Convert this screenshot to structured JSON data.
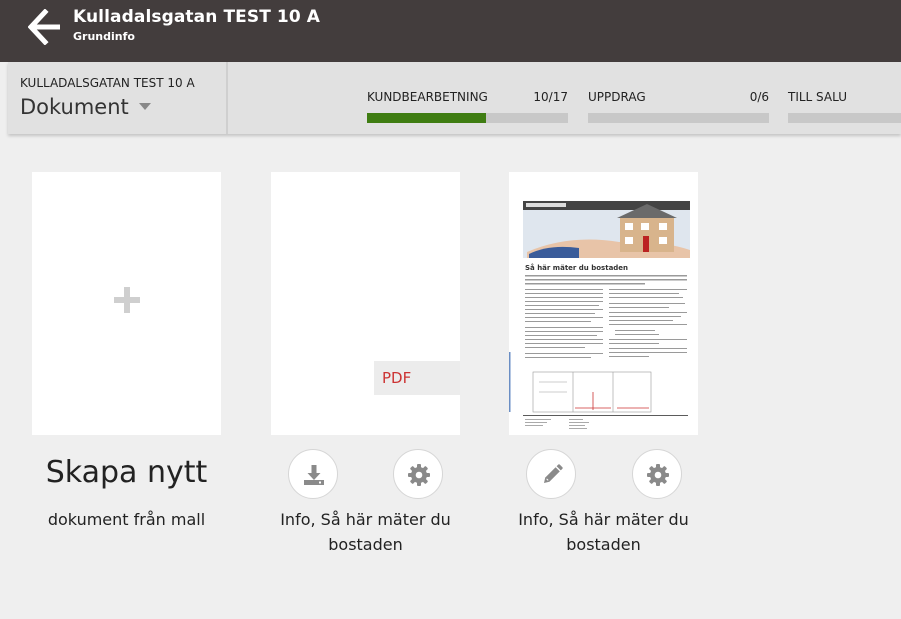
{
  "header": {
    "title": "Kulladalsgatan TEST 10 A",
    "subtitle": "Grundinfo",
    "back_icon": "arrow-left-icon"
  },
  "subheader": {
    "object_name": "KULLADALSGATAN TEST 10 A",
    "section": "Dokument",
    "progress": [
      {
        "label": "KUNDBEARBETNING",
        "count": "10/17",
        "fraction": 0.59,
        "color": "#3f7d12"
      },
      {
        "label": "UPPDRAG",
        "count": "0/6",
        "fraction": 0
      },
      {
        "label": "TILL SALU",
        "count": "",
        "fraction": 0
      }
    ]
  },
  "cards": {
    "create": {
      "title": "Skapa nytt",
      "subtitle": "dokument från mall",
      "icon": "plus-icon"
    },
    "pdf": {
      "tag": "PDF",
      "caption": "Info, Så här mäter du bostaden",
      "buttons": [
        "download-icon",
        "gear-icon"
      ]
    },
    "doc": {
      "caption": "Info, Så här mäter du bostaden",
      "buttons": [
        "pencil-icon",
        "gear-icon"
      ],
      "preview_heading": "Så här mäter du bostaden"
    }
  }
}
